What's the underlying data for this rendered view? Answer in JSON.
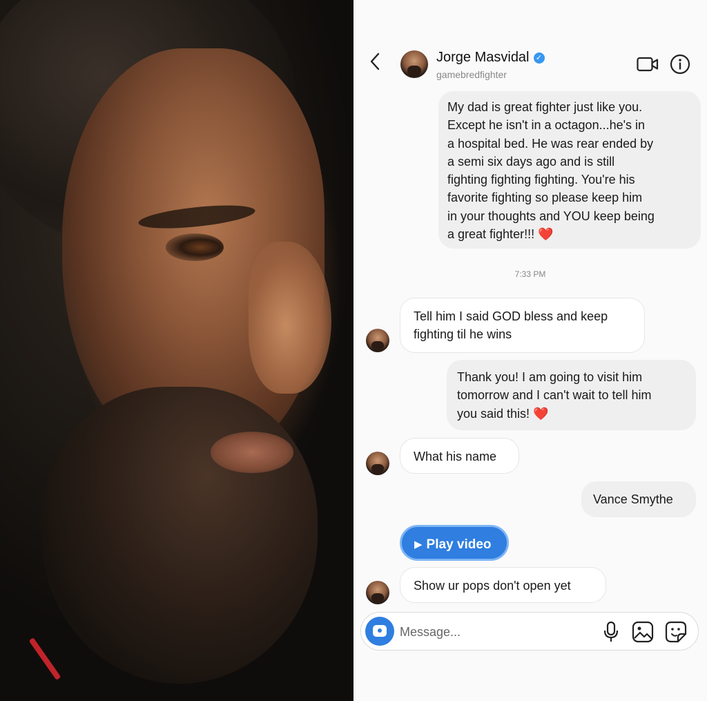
{
  "header": {
    "name": "Jorge Masvidal",
    "username": "gamebredfighter",
    "back_glyph": "‹",
    "verified_glyph": "✓"
  },
  "thread": {
    "msg1_lines": [
      "My dad is great fighter just like you.",
      "Except he isn't in a octagon...he's in",
      "a hospital bed. He was rear ended by",
      "a semi six days ago and is still",
      "fighting fighting fighting. You're his",
      "favorite fighting so please keep him",
      "in your thoughts and YOU keep being",
      "a great fighter!!!"
    ],
    "heart": "❤️",
    "timestamp": "7:33 PM",
    "msg2_lines": [
      "Tell him I said GOD bless and keep",
      "fighting til he wins"
    ],
    "msg3_lines": [
      "Thank you! I am going to visit him",
      "tomorrow and I can't wait to tell him",
      "you said this!"
    ],
    "msg4": "What his name",
    "msg5": "Vance Smythe",
    "play_video": "Play video",
    "play_glyph": "▶",
    "msg6": "Show ur pops don't open yet"
  },
  "composer": {
    "placeholder": "Message..."
  },
  "icons": {
    "back": "chevron-left-icon",
    "video": "video-camera-icon",
    "info": "info-icon",
    "camera": "camera-icon",
    "mic": "microphone-icon",
    "gallery": "image-icon",
    "sticker": "sticker-icon"
  },
  "colors": {
    "accent": "#2f7ee0",
    "verified": "#3897f0",
    "heart": "#e0302e",
    "outgoing_bubble": "#efefef"
  }
}
